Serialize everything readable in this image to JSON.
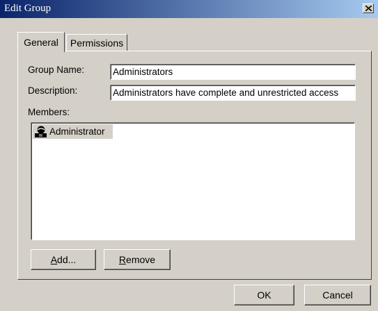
{
  "window": {
    "title": "Edit Group"
  },
  "tabs": [
    {
      "label": "General",
      "active": true
    },
    {
      "label": "Permissions",
      "active": false
    }
  ],
  "general": {
    "group_name_label": "Group Name:",
    "group_name_value": "Administrators",
    "description_label": "Description:",
    "description_value": "Administrators have complete and unrestricted access",
    "members_label": "Members:",
    "members": [
      {
        "name": "Administrator",
        "icon": "user-icon",
        "selected": true
      }
    ],
    "add_button": {
      "mnemonic": "A",
      "rest": "dd..."
    },
    "remove_button": {
      "mnemonic": "R",
      "rest": "emove"
    }
  },
  "footer": {
    "ok_label": "OK",
    "cancel_label": "Cancel"
  },
  "colors": {
    "title_start": "#0a246a",
    "title_end": "#a6caf0",
    "face": "#d4d0c8",
    "selection": "#d4d0c8"
  }
}
